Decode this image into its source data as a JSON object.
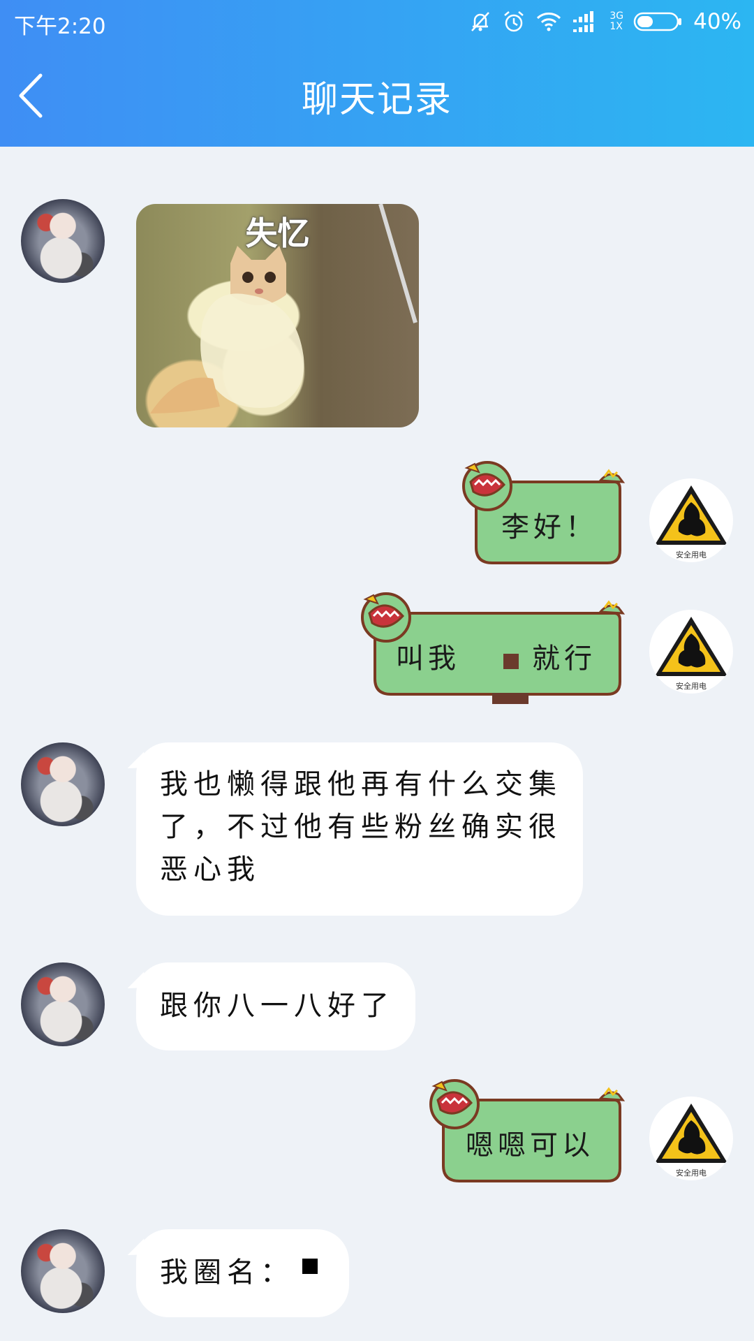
{
  "status_bar": {
    "time": "下午2:20",
    "network_top": "3G",
    "network_bottom": "1X",
    "battery": "40%"
  },
  "nav": {
    "title": "聊天记录"
  },
  "messages": [
    {
      "side": "left",
      "type": "sticker",
      "caption": "失忆"
    },
    {
      "side": "right",
      "type": "green",
      "text": "李好！"
    },
    {
      "side": "right",
      "type": "green",
      "text_a": "叫我",
      "text_b": "就行"
    },
    {
      "side": "left",
      "type": "text",
      "lines": [
        "我也懒得跟他再有什么交集",
        "了，不过他有些粉丝确实很",
        "恶心我"
      ]
    },
    {
      "side": "left",
      "type": "text",
      "lines": [
        "跟你八一八好了"
      ]
    },
    {
      "side": "right",
      "type": "green",
      "text": "嗯嗯可以"
    },
    {
      "side": "left",
      "type": "text",
      "lines": [
        "我圈名："
      ]
    }
  ],
  "avatar_right_label": "安全用电",
  "colors": {
    "header_start": "#3F8EF4",
    "header_end": "#2CB6F2",
    "background": "#EEF2F7",
    "green_bubble": "#8BD08E",
    "green_border": "#7A3A22"
  }
}
